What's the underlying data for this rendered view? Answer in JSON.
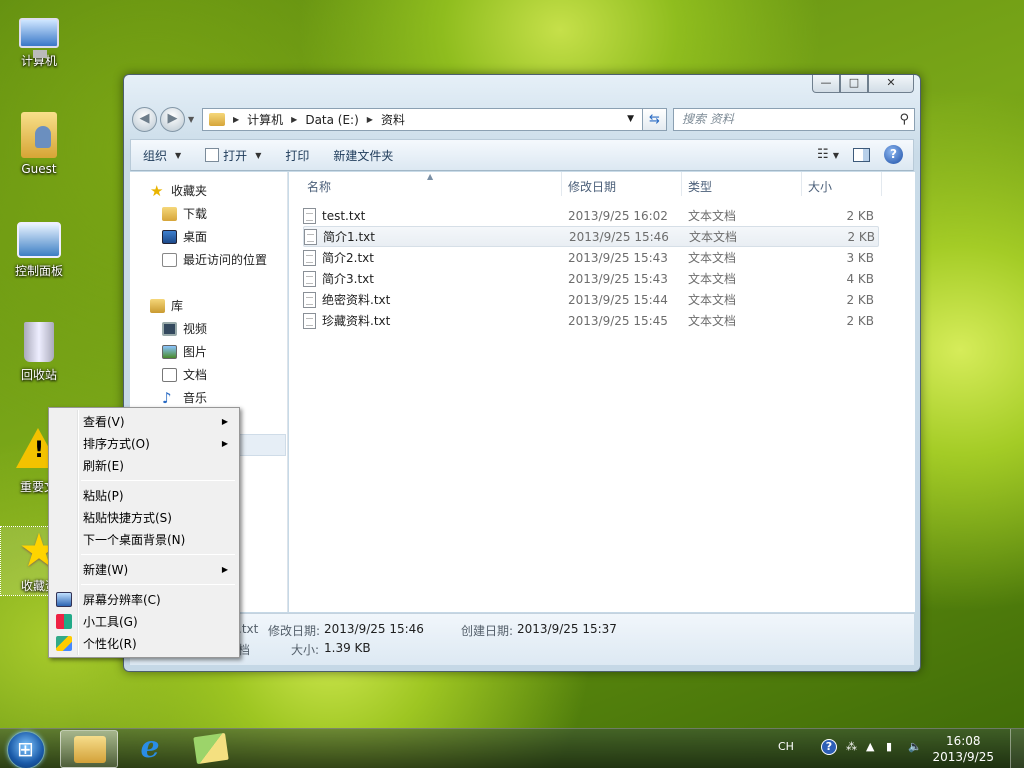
{
  "desktop": {
    "icons": [
      {
        "label": "计算机"
      },
      {
        "label": "Guest"
      },
      {
        "label": "控制面板"
      },
      {
        "label": "回收站"
      },
      {
        "label": "重要文"
      },
      {
        "label": "收藏资"
      }
    ]
  },
  "window": {
    "controls": {
      "minimize": "—",
      "maximize": "□",
      "close": "✕"
    },
    "nav": {
      "back": "◀",
      "forward": "▶"
    },
    "address": {
      "crumbs": [
        "计算机",
        "Data (E:)",
        "资料"
      ]
    },
    "search": {
      "placeholder": "搜索 资料"
    },
    "toolbar": {
      "organize": "组织",
      "open": "打开",
      "print": "打印",
      "new_folder": "新建文件夹"
    },
    "nav_pane": {
      "favorites": "收藏夹",
      "favorites_items": [
        "下载",
        "桌面",
        "最近访问的位置"
      ],
      "libraries": "库",
      "library_items": [
        "视频",
        "图片",
        "文档",
        "音乐"
      ]
    },
    "columns": {
      "name": "名称",
      "date": "修改日期",
      "type": "类型",
      "size": "大小"
    },
    "files": [
      {
        "name": "test.txt",
        "date": "2013/9/25 16:02",
        "type": "文本文档",
        "size": "2 KB"
      },
      {
        "name": "简介1.txt",
        "date": "2013/9/25 15:46",
        "type": "文本文档",
        "size": "2 KB"
      },
      {
        "name": "简介2.txt",
        "date": "2013/9/25 15:43",
        "type": "文本文档",
        "size": "3 KB"
      },
      {
        "name": "简介3.txt",
        "date": "2013/9/25 15:43",
        "type": "文本文档",
        "size": "4 KB"
      },
      {
        "name": "绝密资料.txt",
        "date": "2013/9/25 15:44",
        "type": "文本文档",
        "size": "2 KB"
      },
      {
        "name": "珍藏资料.txt",
        "date": "2013/9/25 15:45",
        "type": "文本文档",
        "size": "2 KB"
      }
    ],
    "details": {
      "name_tail": ".txt",
      "type_tail": "档",
      "modified_label": "修改日期:",
      "modified_value": "2013/9/25 15:46",
      "created_label": "创建日期:",
      "created_value": "2013/9/25 15:37",
      "size_label": "大小:",
      "size_value": "1.39 KB"
    }
  },
  "context_menu": {
    "view": "查看(V)",
    "sort": "排序方式(O)",
    "refresh": "刷新(E)",
    "paste": "粘贴(P)",
    "paste_shortcut": "粘贴快捷方式(S)",
    "next_bg": "下一个桌面背景(N)",
    "new": "新建(W)",
    "resolution": "屏幕分辨率(C)",
    "gadgets": "小工具(G)",
    "personalize": "个性化(R)"
  },
  "taskbar": {
    "lang": "CH",
    "time": "16:08",
    "date": "2013/9/25"
  }
}
